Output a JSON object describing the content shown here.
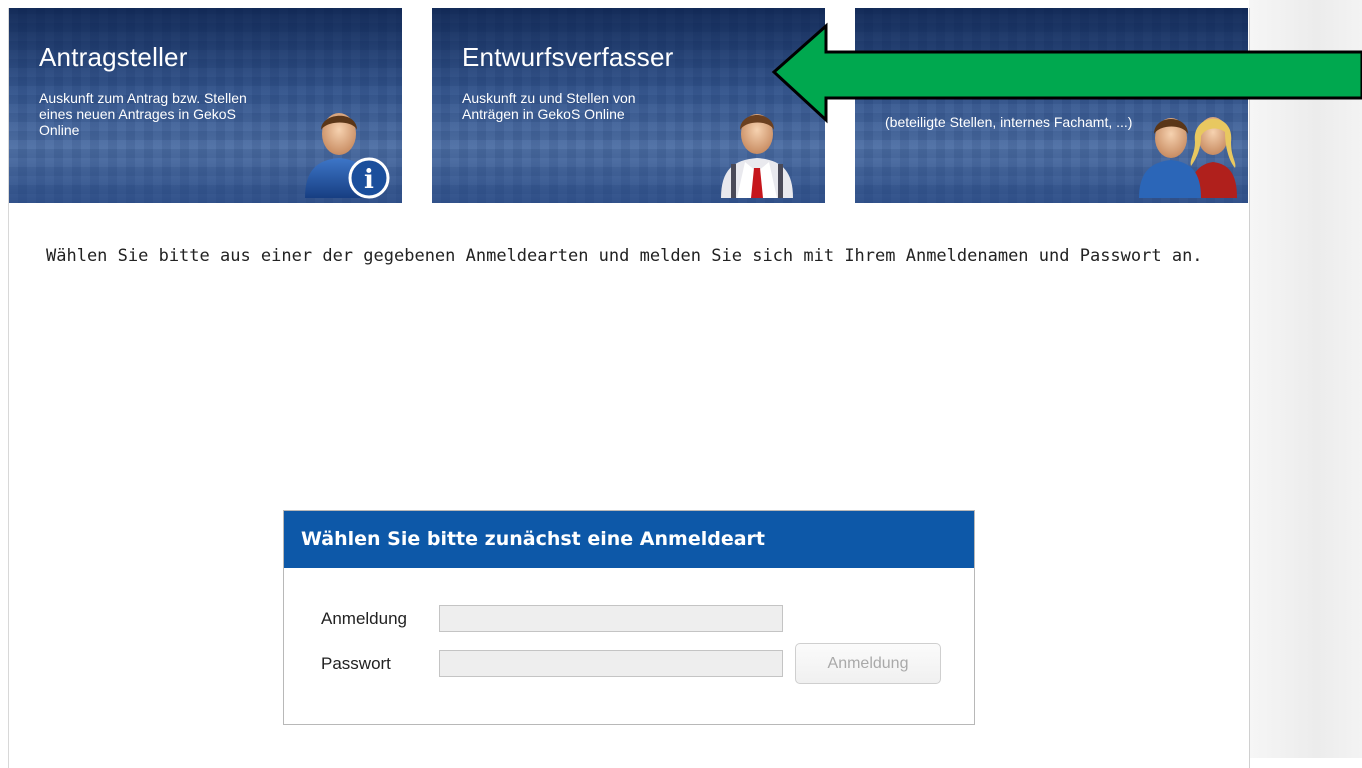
{
  "tiles": [
    {
      "title": "Antragsteller",
      "desc": "Auskunft zum Antrag bzw. Stellen eines neuen Antrages in GekoS Online"
    },
    {
      "title": "Entwurfsverfasser",
      "desc": "Auskunft zu und Stellen von Anträgen in GekoS Online"
    },
    {
      "title": "",
      "desc": "(beteiligte Stellen, internes Fachamt, ...)"
    }
  ],
  "tile_icons": [
    "user-info-icon",
    "businessman-icon",
    "user-group-icon"
  ],
  "intro_text": "Wählen Sie bitte aus einer der gegebenen Anmeldearten und melden Sie sich mit Ihrem Anmeldenamen und Passwort an.",
  "login": {
    "header": "Wählen Sie bitte zunächst eine Anmeldeart",
    "username_label": "Anmeldung",
    "username_value": "",
    "password_label": "Passwort",
    "password_value": "",
    "submit_label": "Anmeldung"
  },
  "colors": {
    "tile_blue": "#3a5e98",
    "header_blue": "#0d58a8",
    "arrow_green": "#00a84f"
  }
}
